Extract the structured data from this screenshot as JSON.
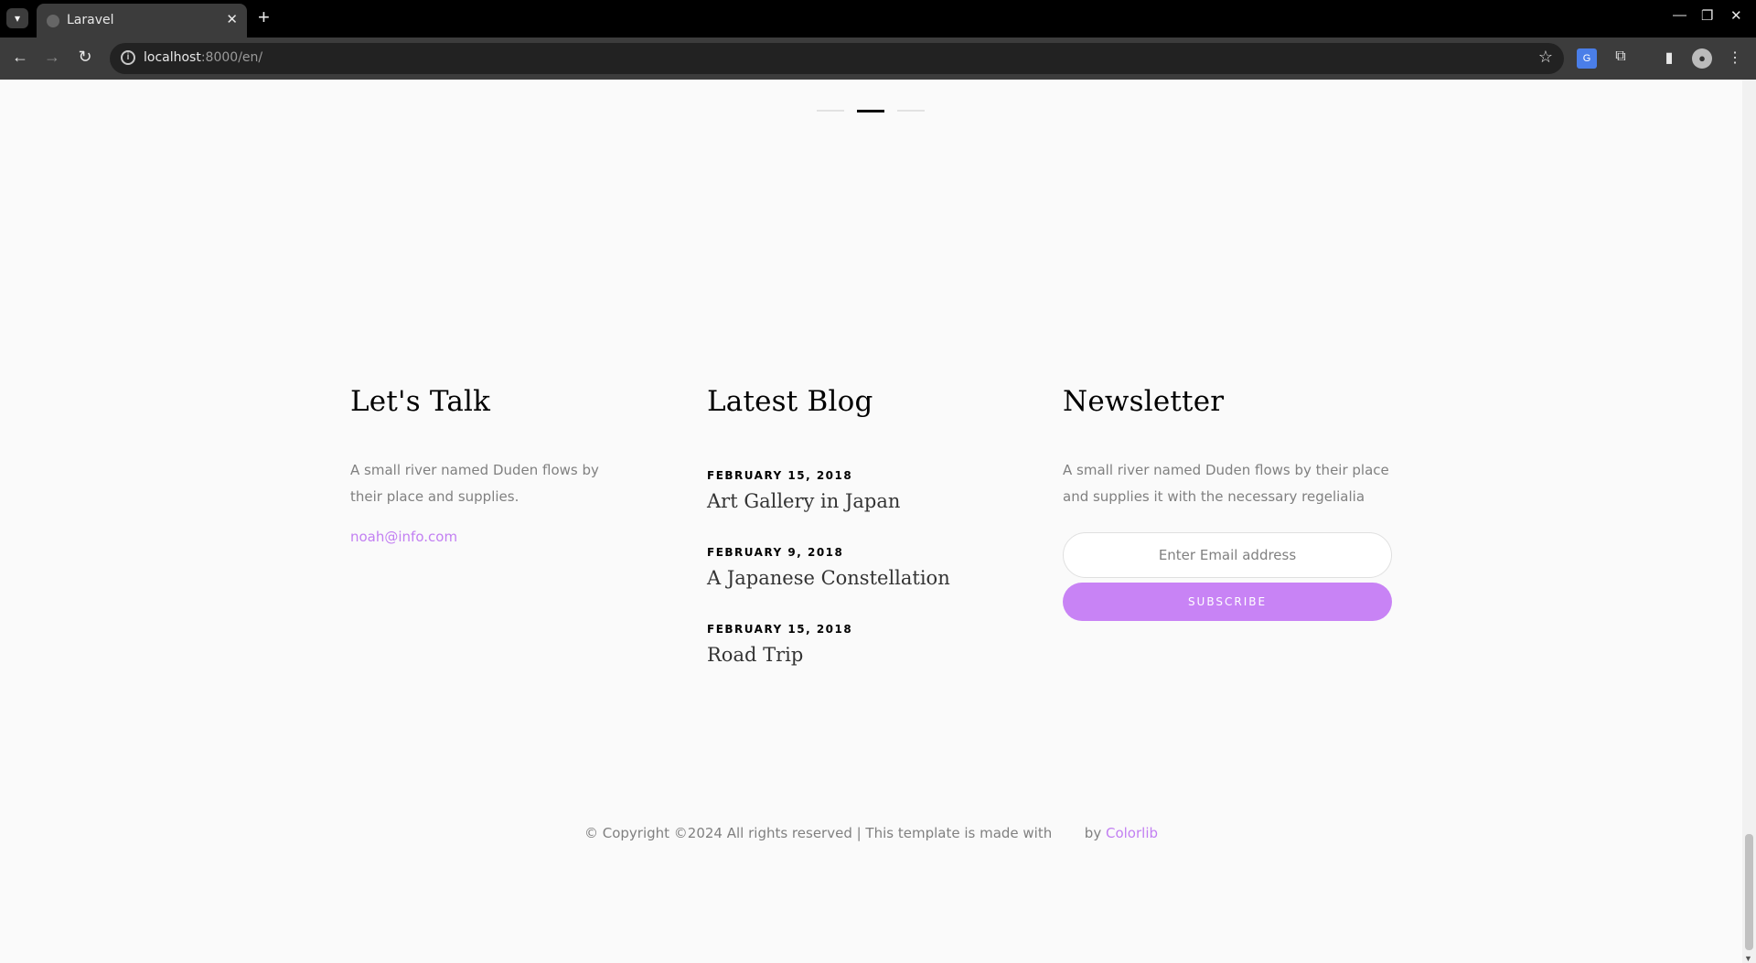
{
  "browser": {
    "tab_title": "Laravel",
    "url_host": "localhost",
    "url_rest": ":8000/en/"
  },
  "page": {
    "lets_talk": {
      "heading": "Let's Talk",
      "description": "A small river named Duden flows by their place and supplies.",
      "email": "noah@info.com"
    },
    "latest_blog": {
      "heading": "Latest Blog",
      "posts": [
        {
          "date": "FEBRUARY 15, 2018",
          "title": "Art Gallery in Japan"
        },
        {
          "date": "FEBRUARY 9, 2018",
          "title": "A Japanese Constellation"
        },
        {
          "date": "FEBRUARY 15, 2018",
          "title": "Road Trip"
        }
      ]
    },
    "newsletter": {
      "heading": "Newsletter",
      "description": "A small river named Duden flows by their place and supplies it with the necessary regelialia",
      "email_placeholder": "Enter Email address",
      "subscribe_label": "SUBSCRIBE"
    },
    "footer": {
      "copyright_text": "© Copyright ©2024 All rights reserved | This template is made with",
      "by_text": "by",
      "brand_link": "Colorlib"
    }
  },
  "colors": {
    "accent": "#c883f5",
    "link": "#c27ff2"
  }
}
